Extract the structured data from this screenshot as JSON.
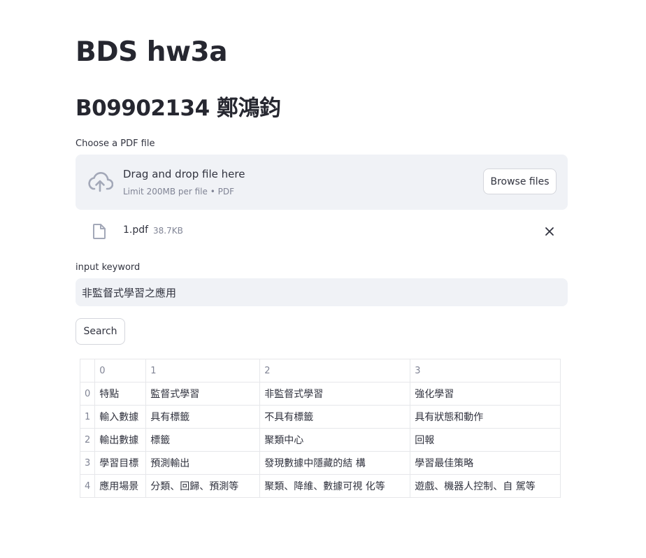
{
  "title": "BDS hw3a",
  "subtitle": "B09902134 鄭鴻鈞",
  "uploader": {
    "label": "Choose a PDF file",
    "drop_main": "Drag and drop file here",
    "drop_sub": "Limit 200MB per file • PDF",
    "browse_label": "Browse files",
    "icon": "cloud-upload-icon"
  },
  "file": {
    "name": "1.pdf",
    "size": "38.7KB",
    "icon": "file-icon",
    "remove_icon": "close-icon"
  },
  "keyword": {
    "label": "input keyword",
    "value": "非監督式學習之應用"
  },
  "search_label": "Search",
  "table": {
    "columns": [
      "",
      "0",
      "1",
      "2",
      "3"
    ],
    "rows": [
      [
        "0",
        "特點",
        "監督式學習",
        "非監督式學習",
        "強化學習"
      ],
      [
        "1",
        "輸入數據",
        "具有標籤",
        "不具有標籤",
        "具有狀態和動作"
      ],
      [
        "2",
        "輸出數據",
        "標籤",
        "聚類中心",
        "回報"
      ],
      [
        "3",
        "學習目標",
        "預測輸出",
        "發現數據中隱藏的結 構",
        "學習最佳策略"
      ],
      [
        "4",
        "應用場景",
        "分類、回歸、預測等",
        "聚類、降維、數據可視 化等",
        "遊戲、機器人控制、自 駕等"
      ]
    ]
  }
}
